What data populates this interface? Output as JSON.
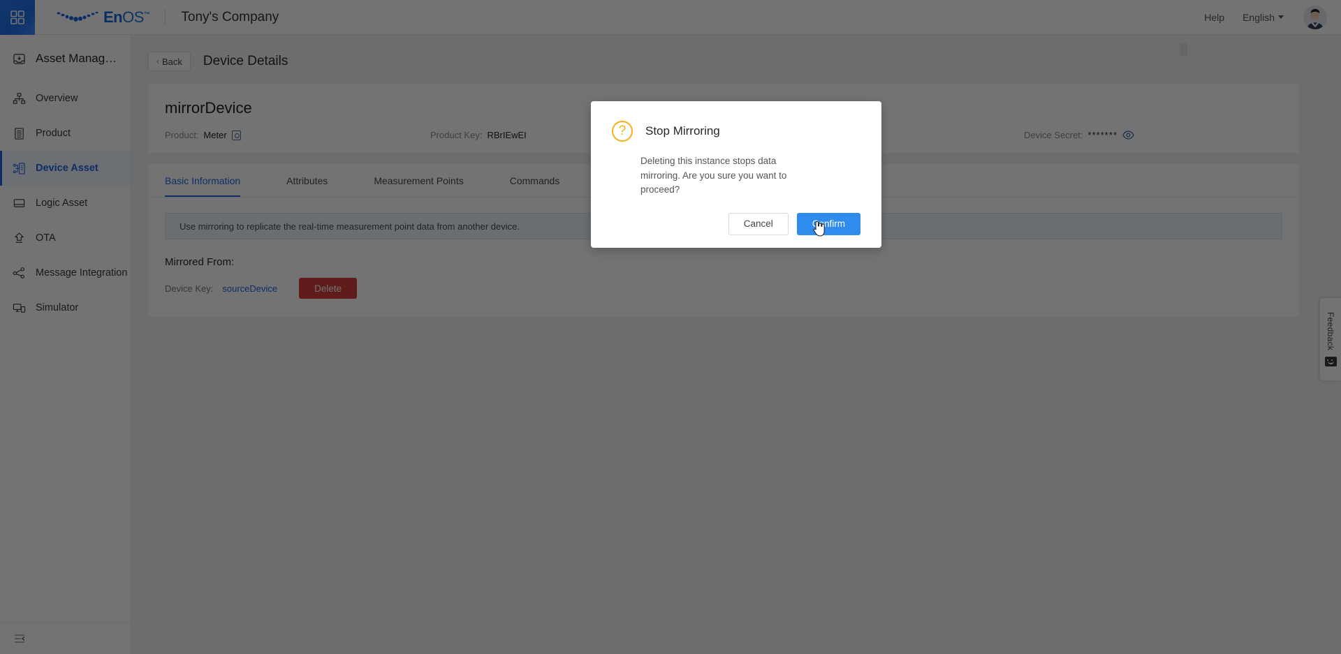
{
  "header": {
    "launcher_icon": "grid-apps-icon",
    "brand_en": "En",
    "brand_os": "OS",
    "brand_tm": "™",
    "company": "Tony's Company",
    "help": "Help",
    "language": "English",
    "avatar_icon": "user-avatar-icon"
  },
  "sidebar": {
    "title": "Asset Manag…",
    "title_icon": "asset-inbox-icon",
    "collapse_icon": "collapse-sidebar-icon",
    "items": [
      {
        "label": "Overview",
        "icon": "hierarchy-icon",
        "active": false
      },
      {
        "label": "Product",
        "icon": "document-list-icon",
        "active": false
      },
      {
        "label": "Device Asset",
        "icon": "device-node-icon",
        "active": true
      },
      {
        "label": "Logic Asset",
        "icon": "logic-box-icon",
        "active": false
      },
      {
        "label": "OTA",
        "icon": "upload-arrow-icon",
        "active": false
      },
      {
        "label": "Message Integration",
        "icon": "share-nodes-icon",
        "active": false
      },
      {
        "label": "Simulator",
        "icon": "simulator-screen-icon",
        "active": false
      }
    ]
  },
  "page": {
    "back_label": "Back",
    "back_icon": "chevron-left-icon",
    "title": "Device Details"
  },
  "device": {
    "name": "mirrorDevice",
    "product_label": "Product:",
    "product_value": "Meter",
    "product_copy_icon": "copy-product-icon",
    "product_key_label": "Product Key:",
    "product_key_value": "RBrIEwEI",
    "device_secret_label": "Device Secret:",
    "device_secret_value": "*******",
    "device_secret_eye_icon": "eye-reveal-icon"
  },
  "tabs": [
    {
      "label": "Basic Information",
      "active": true
    },
    {
      "label": "Attributes",
      "active": false
    },
    {
      "label": "Measurement Points",
      "active": false
    },
    {
      "label": "Commands",
      "active": false
    }
  ],
  "mirroring": {
    "notice": "Use mirroring to replicate the real-time measurement point data from another device.",
    "mirrored_from_label": "Mirrored From:",
    "device_key_label": "Device Key:",
    "device_key_value": "sourceDevice",
    "delete_label": "Delete"
  },
  "feedback": {
    "label": "Feedback",
    "icon": "smiley-feedback-icon"
  },
  "modal": {
    "icon": "question-mark-icon",
    "title": "Stop Mirroring",
    "message": "Deleting this instance stops data mirroring. Are you sure you want to proceed?",
    "cancel_label": "Cancel",
    "confirm_label": "Confirm"
  },
  "colors": {
    "brand_blue": "#1464e0",
    "accent_blue": "#2066e0",
    "confirm_blue": "#2f8ced",
    "danger_red": "#d63c3c",
    "warning_orange": "#faad14"
  }
}
